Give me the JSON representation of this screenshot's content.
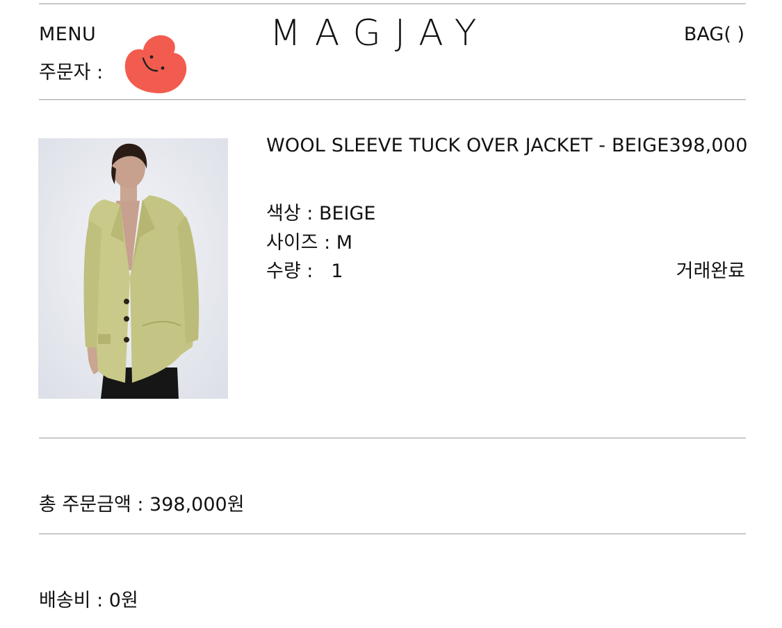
{
  "header": {
    "menu_label": "MENU",
    "logo": "MAGJAY",
    "bag_label": "BAG( )",
    "orderer_label": "주문자 :"
  },
  "product": {
    "name": "WOOL SLEEVE TUCK OVER JACKET - BEIGE",
    "price": "398,000",
    "color_label": "색상 : BEIGE",
    "size_label": "사이즈 : M",
    "quantity_label": "수량 :",
    "quantity_value": "1",
    "status": "거래완료"
  },
  "summary": {
    "total_label": "총 주문금액 : 398,000원",
    "shipping_label": "배송비 : 0원"
  },
  "colors": {
    "divider": "#9a9a9a",
    "sticker": "#f25c4f",
    "jacket": "#c9c98a"
  },
  "icons": {
    "sticker": "smiley-heart-sticker"
  }
}
